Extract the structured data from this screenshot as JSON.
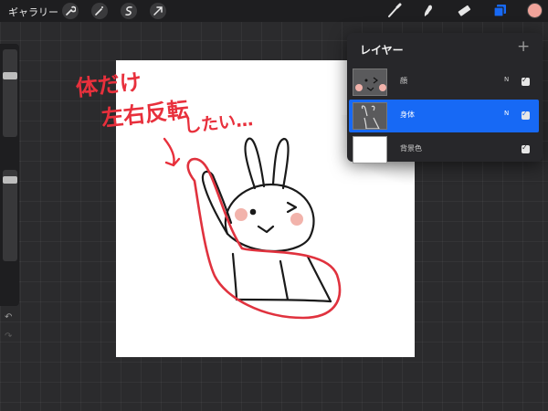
{
  "topbar": {
    "gallery_label": "ギャラリー",
    "tools_left": [
      "wrench-icon",
      "magic-wand-icon",
      "selection-icon",
      "transform-arrow-icon"
    ],
    "tools_right": [
      "brush-icon",
      "smudge-icon",
      "eraser-icon",
      "layers-icon"
    ],
    "accent_color": "#1769f5",
    "current_color": "#f0a39a"
  },
  "sidebar": {
    "brush_size_level": 0.28,
    "opacity_level": 0.28
  },
  "annotation": {
    "lines": [
      "体だけ",
      "左右反転",
      "したい…"
    ],
    "color": "#e8303c"
  },
  "layers": {
    "title": "レイヤー",
    "add_label": "+",
    "items": [
      {
        "name": "顔",
        "mode": "N",
        "visible": true,
        "selected": false
      },
      {
        "name": "身体",
        "mode": "N",
        "visible": true,
        "selected": true
      },
      {
        "name": "背景色",
        "mode": "",
        "visible": true,
        "selected": false
      }
    ]
  }
}
